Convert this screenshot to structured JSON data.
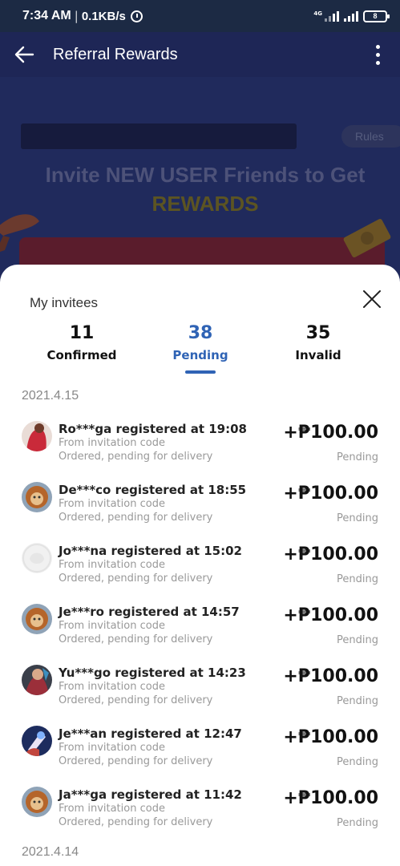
{
  "status_bar": {
    "time": "7:34 AM",
    "separator": "|",
    "network_rate": "0.1KB/s",
    "network_type": "4G",
    "battery": "8"
  },
  "header": {
    "title": "Referral Rewards"
  },
  "banner": {
    "rules_label": "Rules",
    "headline_line1": "Invite NEW USER Friends to Get",
    "headline_line2": "REWARDS"
  },
  "sheet": {
    "title": "My invitees",
    "tabs": [
      {
        "count": "11",
        "label": "Confirmed"
      },
      {
        "count": "38",
        "label": "Pending",
        "active": true
      },
      {
        "count": "35",
        "label": "Invalid"
      }
    ],
    "groups": [
      {
        "date": "2021.4.15",
        "items": [
          {
            "title": "Ro***ga registered at 19:08",
            "source": "From invitation code",
            "detail": "Ordered, pending for delivery",
            "amount": "+₱100.00",
            "status": "Pending"
          },
          {
            "title": "De***co registered at 18:55",
            "source": "From invitation code",
            "detail": "Ordered, pending for delivery",
            "amount": "+₱100.00",
            "status": "Pending"
          },
          {
            "title": "Jo***na registered at 15:02",
            "source": "From invitation code",
            "detail": "Ordered, pending for delivery",
            "amount": "+₱100.00",
            "status": "Pending"
          },
          {
            "title": "Je***ro registered at 14:57",
            "source": "From invitation code",
            "detail": "Ordered, pending for delivery",
            "amount": "+₱100.00",
            "status": "Pending"
          },
          {
            "title": "Yu***go registered at 14:23",
            "source": "From invitation code",
            "detail": "Ordered, pending for delivery",
            "amount": "+₱100.00",
            "status": "Pending"
          },
          {
            "title": "Je***an registered at 12:47",
            "source": "From invitation code",
            "detail": "Ordered, pending for delivery",
            "amount": "+₱100.00",
            "status": "Pending"
          },
          {
            "title": "Ja***ga registered at 11:42",
            "source": "From invitation code",
            "detail": "Ordered, pending for delivery",
            "amount": "+₱100.00",
            "status": "Pending"
          }
        ]
      },
      {
        "date": "2021.4.14",
        "items": []
      }
    ]
  },
  "colors": {
    "accent": "#2f63b5",
    "header_bg": "#1e2656",
    "status_bar_bg": "#1c2a44"
  }
}
